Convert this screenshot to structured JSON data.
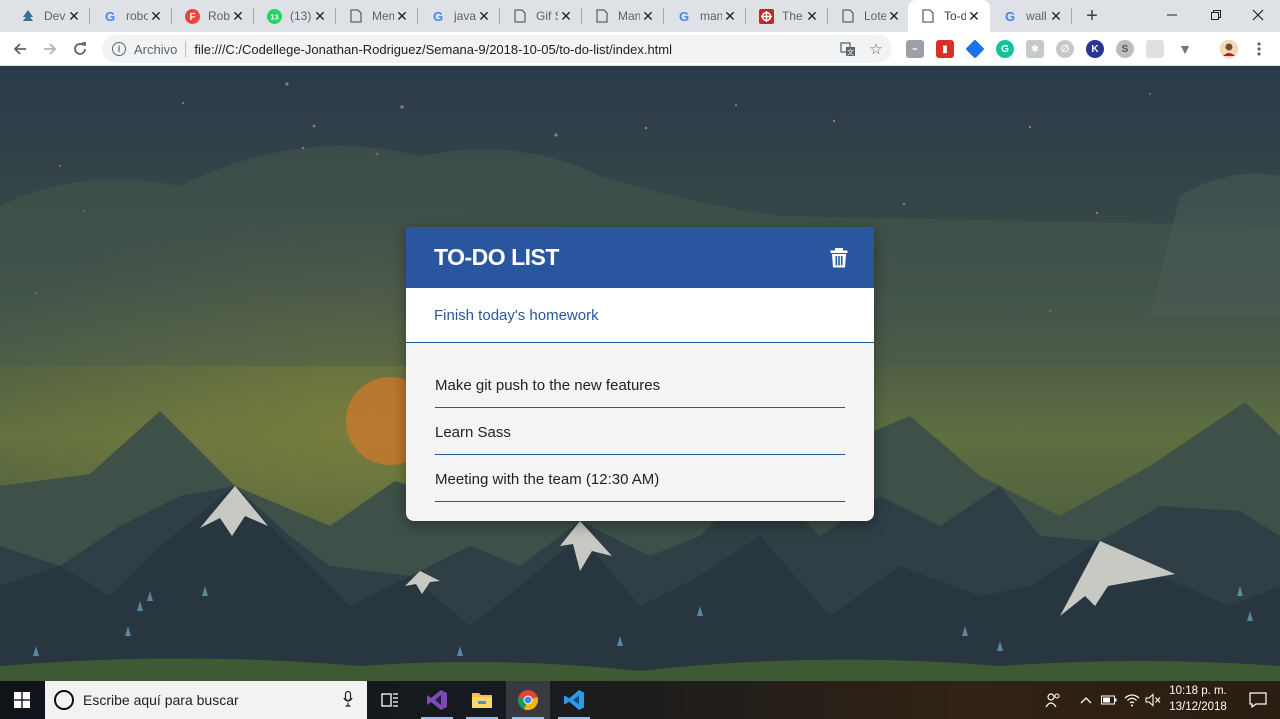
{
  "browser": {
    "tabs": [
      {
        "title": "Devs",
        "favicon": "tree-icon",
        "color": "#3c6e8f"
      },
      {
        "title": "robot",
        "favicon": "google-icon",
        "color": "#4285f4"
      },
      {
        "title": "Robot",
        "favicon": "f-logo-icon",
        "color": "#e8453c"
      },
      {
        "title": "(13)",
        "favicon": "whatsapp-icon",
        "color": "#25d366",
        "badge": "13"
      },
      {
        "title": "Mem",
        "favicon": "document-icon",
        "color": "#5f6368"
      },
      {
        "title": "java",
        "favicon": "google-icon",
        "color": "#4285f4"
      },
      {
        "title": "Gif S",
        "favicon": "document-icon",
        "color": "#5f6368"
      },
      {
        "title": "Man",
        "favicon": "document-icon",
        "color": "#5f6368"
      },
      {
        "title": "man",
        "favicon": "google-icon",
        "color": "#4285f4"
      },
      {
        "title": "The",
        "favicon": "puzzle-icon",
        "color": "#c62828"
      },
      {
        "title": "Lote",
        "favicon": "document-icon",
        "color": "#5f6368"
      },
      {
        "title": "To-d",
        "favicon": "document-icon",
        "color": "#5f6368",
        "active": true
      },
      {
        "title": "wall",
        "favicon": "google-icon",
        "color": "#4285f4"
      }
    ],
    "address": {
      "scheme_label": "Archivo",
      "url": "file:///C:/Codellege-Jonathan-Rodriguez/Semana-9/2018-10-05/to-do-list/index.html"
    }
  },
  "page": {
    "title": "TO-DO LIST",
    "input_value": "Finish today's homework",
    "items": [
      "Make git push to the new features",
      "Learn Sass",
      "Meeting with the team (12:30 AM)"
    ],
    "accent_color": "#2a56a0"
  },
  "taskbar": {
    "search_placeholder": "Escribe aquí para buscar",
    "time": "10:18 p. m.",
    "date": "13/12/2018"
  }
}
